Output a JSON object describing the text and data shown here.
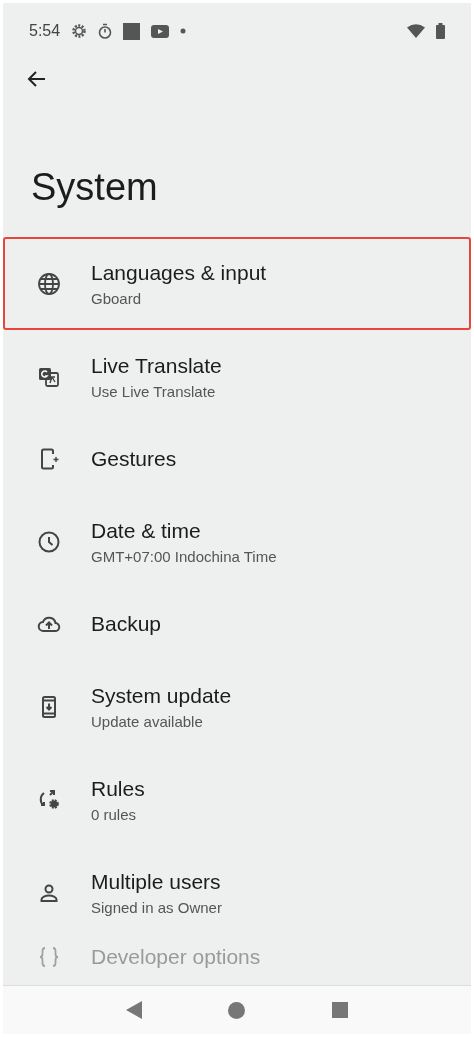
{
  "status_bar": {
    "time": "5:54"
  },
  "title": "System",
  "items": [
    {
      "title": "Languages & input",
      "subtitle": "Gboard",
      "highlighted": true
    },
    {
      "title": "Live Translate",
      "subtitle": "Use Live Translate",
      "highlighted": false
    },
    {
      "title": "Gestures",
      "highlighted": false
    },
    {
      "title": "Date & time",
      "subtitle": "GMT+07:00 Indochina Time",
      "highlighted": false
    },
    {
      "title": "Backup",
      "highlighted": false
    },
    {
      "title": "System update",
      "subtitle": "Update available",
      "highlighted": false
    },
    {
      "title": "Rules",
      "subtitle": "0 rules",
      "highlighted": false
    },
    {
      "title": "Multiple users",
      "subtitle": "Signed in as Owner",
      "highlighted": false
    },
    {
      "title": "Developer options",
      "highlighted": false
    }
  ]
}
